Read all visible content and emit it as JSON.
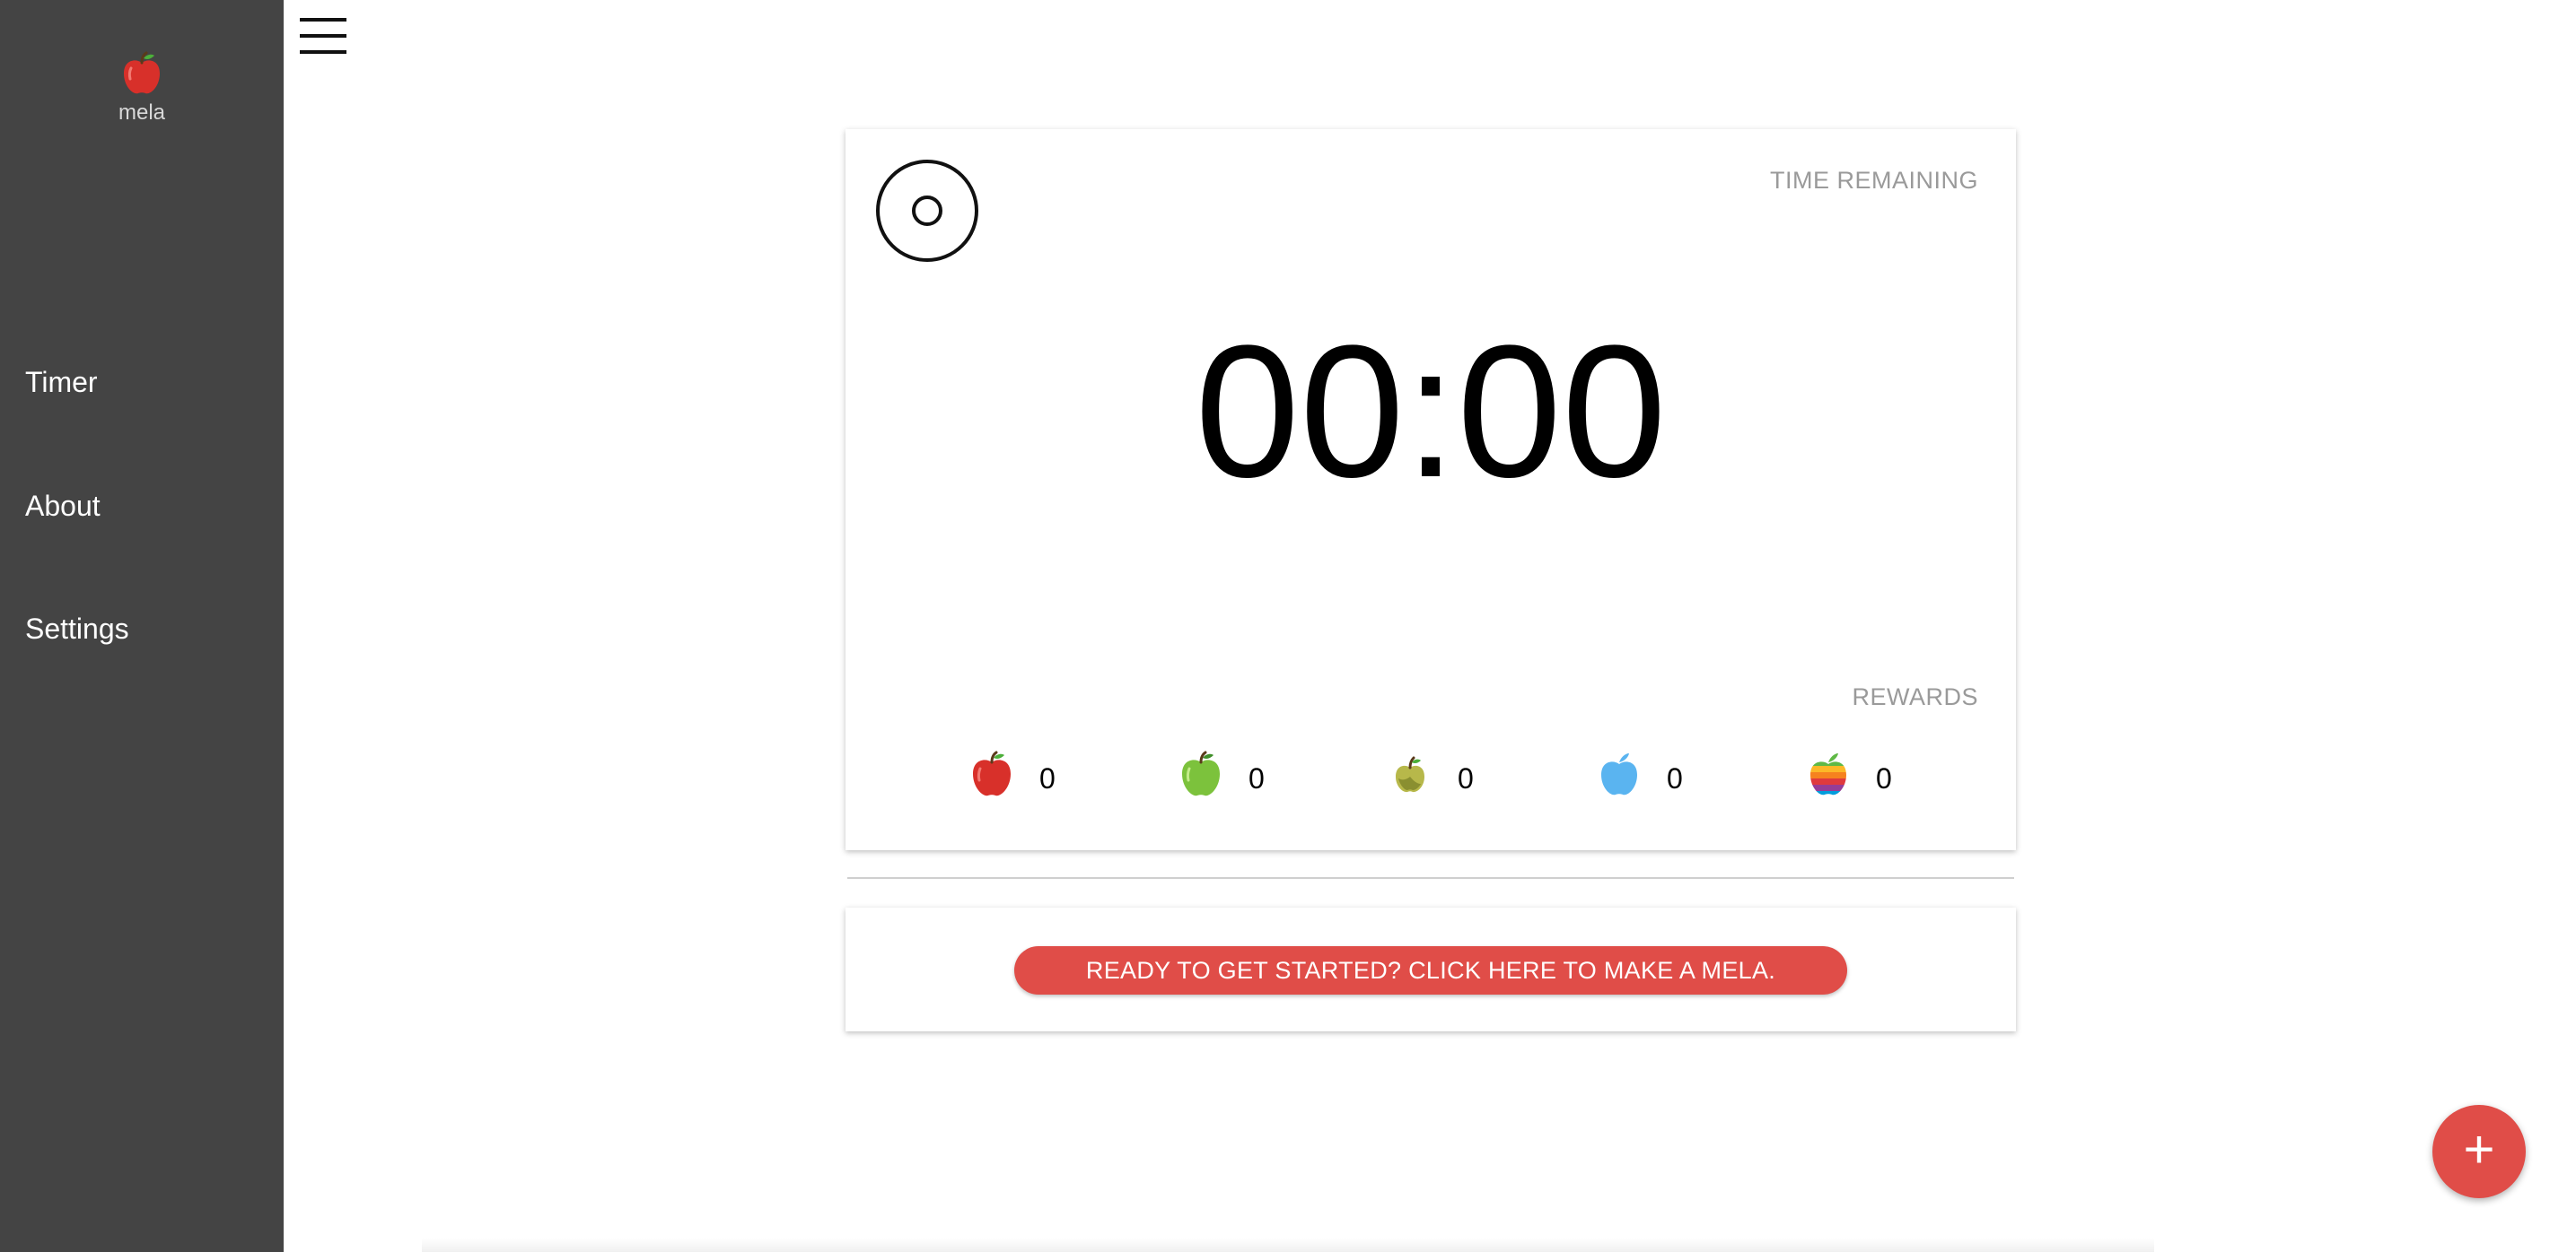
{
  "sidebar": {
    "logo_text": "mela",
    "items": [
      {
        "label": "Timer"
      },
      {
        "label": "About"
      },
      {
        "label": "Settings"
      }
    ]
  },
  "timer": {
    "time_remaining_label": "TIME REMAINING",
    "time": "00:00",
    "rewards_label": "REWARDS",
    "rewards": [
      {
        "icon": "red-apple-icon",
        "count": "0",
        "color": "#d8302a"
      },
      {
        "icon": "green-apple-icon",
        "count": "0",
        "color": "#7cc23c"
      },
      {
        "icon": "golden-apple-icon",
        "count": "0",
        "color": "#b7b84a"
      },
      {
        "icon": "blue-apple-icon",
        "count": "0",
        "color": "#5ab4f0"
      },
      {
        "icon": "rainbow-apple-icon",
        "count": "0",
        "color": "#f0a030"
      }
    ]
  },
  "cta": {
    "label": "READY TO GET STARTED? CLICK HERE TO MAKE A MELA."
  },
  "fab": {
    "label": "+"
  },
  "colors": {
    "sidebar_bg": "#444444",
    "accent": "#e04d48"
  }
}
